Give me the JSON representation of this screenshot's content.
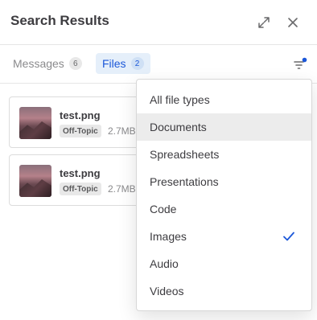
{
  "header": {
    "title": "Search Results"
  },
  "tabs": [
    {
      "label": "Messages",
      "count": "6"
    },
    {
      "label": "Files",
      "count": "2"
    }
  ],
  "files": [
    {
      "name": "test.png",
      "channel": "Off-Topic",
      "size": "2.7MB"
    },
    {
      "name": "test.png",
      "channel": "Off-Topic",
      "size": "2.7MB"
    }
  ],
  "filter_menu": {
    "items": [
      {
        "label": "All file types"
      },
      {
        "label": "Documents"
      },
      {
        "label": "Spreadsheets"
      },
      {
        "label": "Presentations"
      },
      {
        "label": "Code"
      },
      {
        "label": "Images"
      },
      {
        "label": "Audio"
      },
      {
        "label": "Videos"
      }
    ],
    "selected": "Images",
    "hovered": "Documents"
  },
  "colors": {
    "accent": "#1c58d9",
    "filter_dot": "#1c58d9",
    "check": "#1c58d9"
  },
  "icons": {
    "expand": "expand-icon",
    "close": "close-icon",
    "filter": "filter-icon",
    "check": "checkmark-icon"
  }
}
